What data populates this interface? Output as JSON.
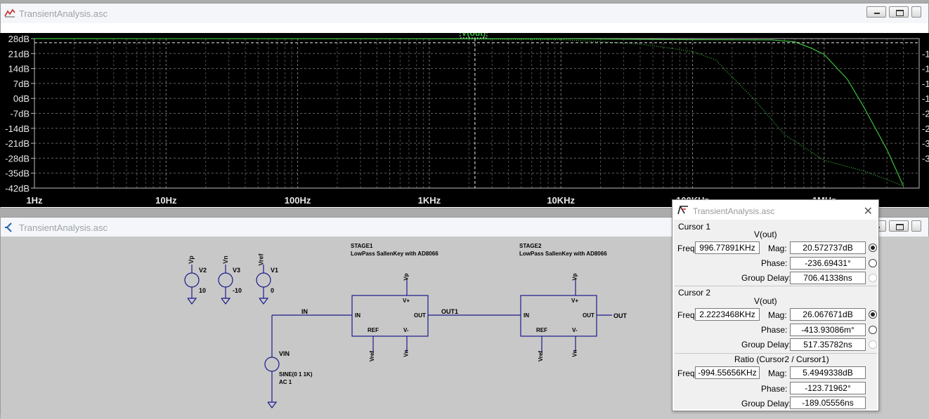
{
  "plot_window": {
    "title": "TransientAnalysis.asc",
    "trace_label": "V(out)",
    "y_ticks": [
      "28dB",
      "21dB",
      "14dB",
      "7dB",
      "0dB",
      "-7dB",
      "-14dB",
      "-21dB",
      "-28dB",
      "-35dB",
      "-42dB"
    ],
    "x_ticks": [
      "1Hz",
      "10Hz",
      "100Hz",
      "1KHz",
      "10KHz",
      "100KHz",
      "1MHz"
    ],
    "right_ticks": [
      "-1",
      "-1",
      "-1",
      "-1",
      "-2",
      "-2",
      "-3",
      "-3"
    ],
    "trace_color": "#3cbf3c"
  },
  "chart_data": {
    "type": "line",
    "x_scale": "log",
    "xlim_hz": [
      1,
      4000000
    ],
    "ylim_db": [
      -42,
      28
    ],
    "grid": true,
    "series": [
      {
        "name": "V(out)",
        "style": "solid",
        "points": [
          [
            1,
            28
          ],
          [
            10000,
            27.9
          ],
          [
            100000,
            27.5
          ],
          [
            400000,
            27.4
          ],
          [
            600000,
            26.5
          ],
          [
            800000,
            23.5
          ],
          [
            1000000,
            20.6
          ],
          [
            1500000,
            9
          ],
          [
            2000000,
            -4
          ],
          [
            3000000,
            -24
          ],
          [
            4000000,
            -41
          ]
        ]
      },
      {
        "name": "",
        "style": "dotted",
        "points": [
          [
            1,
            28
          ],
          [
            1000,
            27.9
          ],
          [
            10000,
            27.5
          ],
          [
            40000,
            25.5
          ],
          [
            100000,
            22
          ],
          [
            150000,
            18
          ],
          [
            200000,
            10
          ],
          [
            300000,
            -1
          ],
          [
            500000,
            -17
          ],
          [
            1000000,
            -29
          ],
          [
            2000000,
            -34
          ],
          [
            3000000,
            -38
          ],
          [
            4000000,
            -41
          ]
        ]
      }
    ]
  },
  "schem_window": {
    "title": "TransientAnalysis.asc",
    "labels": {
      "vp": "Vp",
      "vn": "Vn",
      "vref": "Vref",
      "v2": "V2",
      "v3": "V3",
      "v1": "V1",
      "v2_val": "10",
      "v3_val": "-10",
      "v1_val": "0",
      "in": "IN",
      "out1": "OUT1",
      "out": "OUT",
      "stage1": "STAGE1",
      "stage1_desc": "LowPass SallenKey with AD8066",
      "stage2": "STAGE2",
      "stage2_desc": "LowPass SallenKey with AD8066",
      "pin_in": "IN",
      "pin_out": "OUT",
      "pin_vp": "V+",
      "pin_vn": "V-",
      "pin_ref": "REF",
      "vin": "VIN",
      "vin_src": "SINE(0 1 1K)",
      "vin_ac": "AC 1"
    }
  },
  "cursor_dialog": {
    "title": "TransientAnalysis.asc",
    "cursor1": {
      "heading": "Cursor 1",
      "trace": "V(out)",
      "freq_label": "Freq:",
      "freq": "996.77891KHz",
      "mag_label": "Mag:",
      "mag": "20.572737dB",
      "phase_label": "Phase:",
      "phase": "-236.69431°",
      "gd_label": "Group Delay:",
      "gd": "706.41338ns"
    },
    "cursor2": {
      "heading": "Cursor 2",
      "trace": "V(out)",
      "freq_label": "Freq:",
      "freq": "2.2223468KHz",
      "mag_label": "Mag:",
      "mag": "26.067671dB",
      "phase_label": "Phase:",
      "phase": "-413.93086m°",
      "gd_label": "Group Delay:",
      "gd": "517.35782ns"
    },
    "ratio": {
      "heading": "Ratio (Cursor2 / Cursor1)",
      "freq_label": "Freq:",
      "freq": "-994.55656KHz",
      "mag_label": "Mag:",
      "mag": "5.4949338dB",
      "phase_label": "Phase:",
      "phase": "-123.71962°",
      "gd_label": "Group Delay:",
      "gd": "-189.05556ns"
    }
  }
}
